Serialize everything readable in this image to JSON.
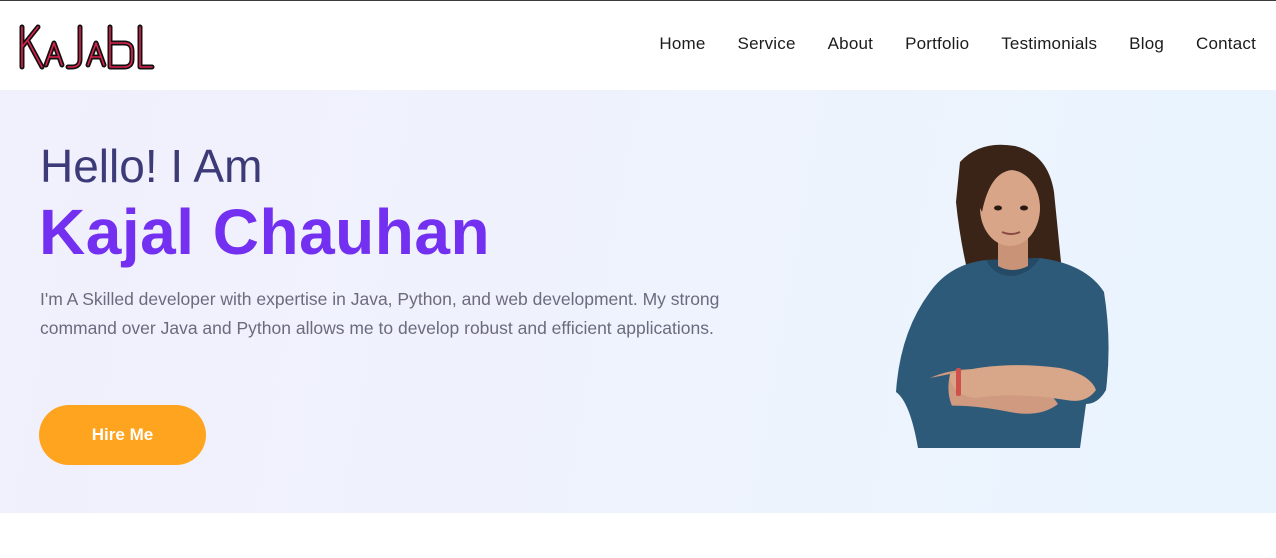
{
  "header": {
    "logo_text": "KaJal",
    "nav": [
      "Home",
      "Service",
      "About",
      "Portfolio",
      "Testimonials",
      "Blog",
      "Contact"
    ]
  },
  "hero": {
    "greeting": "Hello! I Am",
    "name": "Kajal Chauhan",
    "description": "I'm A Skilled developer with expertise in Java, Python, and web development. My strong command over Java and Python allows me to develop robust and efficient applications.",
    "cta_label": "Hire Me"
  },
  "colors": {
    "accent": "#7330f0",
    "greeting": "#3d3a78",
    "button": "#ffa41f",
    "logo_stroke": "#e0224f",
    "hero_bg": "#eef3fd"
  }
}
